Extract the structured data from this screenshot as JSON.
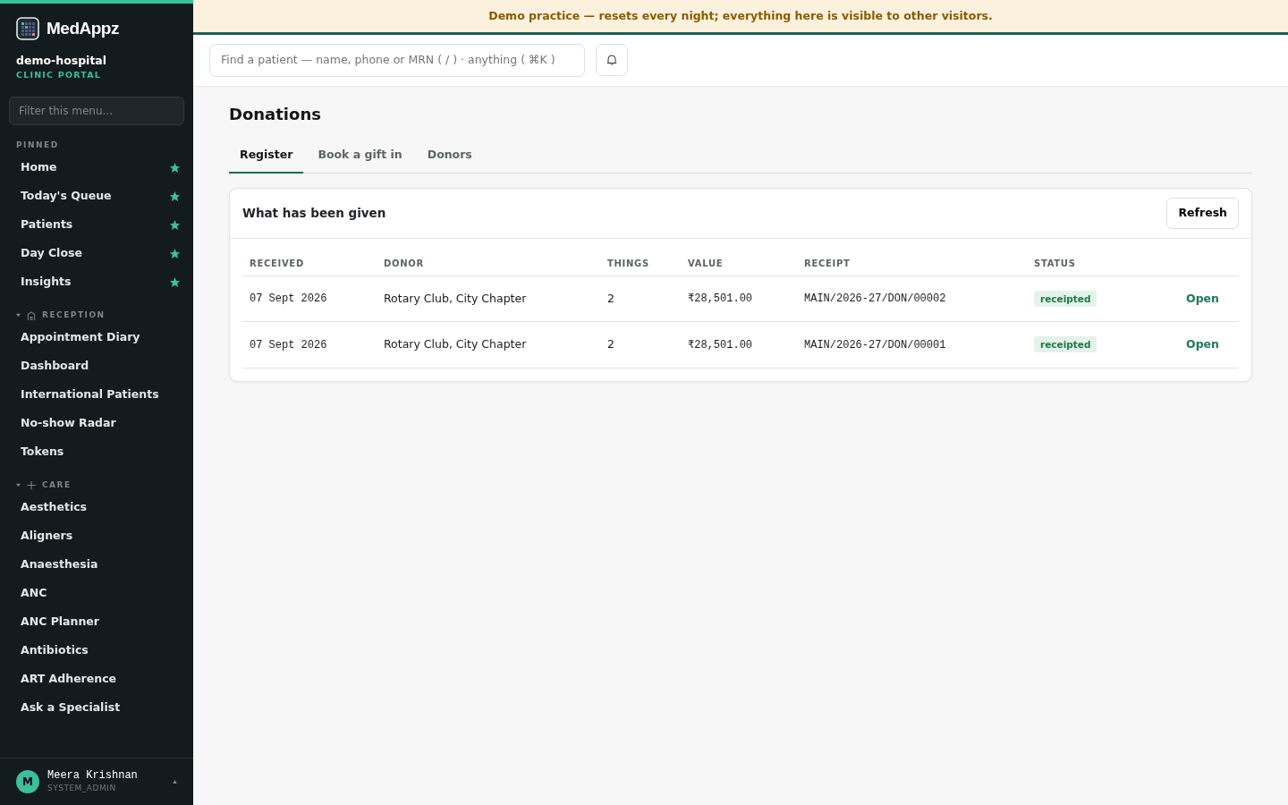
{
  "brand": {
    "name": "MedAppz",
    "org": "demo-hospital",
    "portal": "CLINIC PORTAL"
  },
  "sidebar": {
    "filter_placeholder": "Filter this menu...",
    "pinned": {
      "title": "PINNED",
      "items": [
        {
          "label": "Home",
          "starred": true
        },
        {
          "label": "Today's Queue",
          "starred": true
        },
        {
          "label": "Patients",
          "starred": true
        },
        {
          "label": "Day Close",
          "starred": true
        },
        {
          "label": "Insights",
          "starred": true
        }
      ]
    },
    "groups": [
      {
        "title": "RECEPTION",
        "kind": "building",
        "expanded": true,
        "items": [
          "Appointment Diary",
          "Dashboard",
          "International Patients",
          "No-show Radar",
          "Tokens"
        ]
      },
      {
        "title": "CARE",
        "kind": "plus",
        "expanded": true,
        "items": [
          "Aesthetics",
          "Aligners",
          "Anaesthesia",
          "ANC",
          "ANC Planner",
          "Antibiotics",
          "ART Adherence",
          "Ask a Specialist"
        ]
      }
    ]
  },
  "user": {
    "initial": "M",
    "name": "Meera Krishnan",
    "role": "SYSTEM_ADMIN"
  },
  "banner": "Demo practice — resets every night; everything here is visible to other visitors.",
  "search": {
    "placeholder": "Find a patient — name, phone or MRN ( / ) · anything ( ⌘K )"
  },
  "page": {
    "title": "Donations",
    "tabs": [
      {
        "label": "Register",
        "selected": true
      },
      {
        "label": "Book a gift in",
        "selected": false
      },
      {
        "label": "Donors",
        "selected": false
      }
    ],
    "card": {
      "title": "What has been given",
      "button": "Refresh",
      "columns": [
        "RECEIVED",
        "DONOR",
        "THINGS",
        "VALUE",
        "RECEIPT",
        "STATUS"
      ],
      "rows": [
        {
          "received": "07 Sept 2026",
          "donor": "Rotary Club, City Chapter",
          "things": "2",
          "value": "₹28,501.00",
          "receipt": "MAIN/2026-27/DON/00002",
          "status": "receipted",
          "action": "Open"
        },
        {
          "received": "07 Sept 2026",
          "donor": "Rotary Club, City Chapter",
          "things": "2",
          "value": "₹28,501.00",
          "receipt": "MAIN/2026-27/DON/00001",
          "status": "receipted",
          "action": "Open"
        }
      ]
    }
  }
}
